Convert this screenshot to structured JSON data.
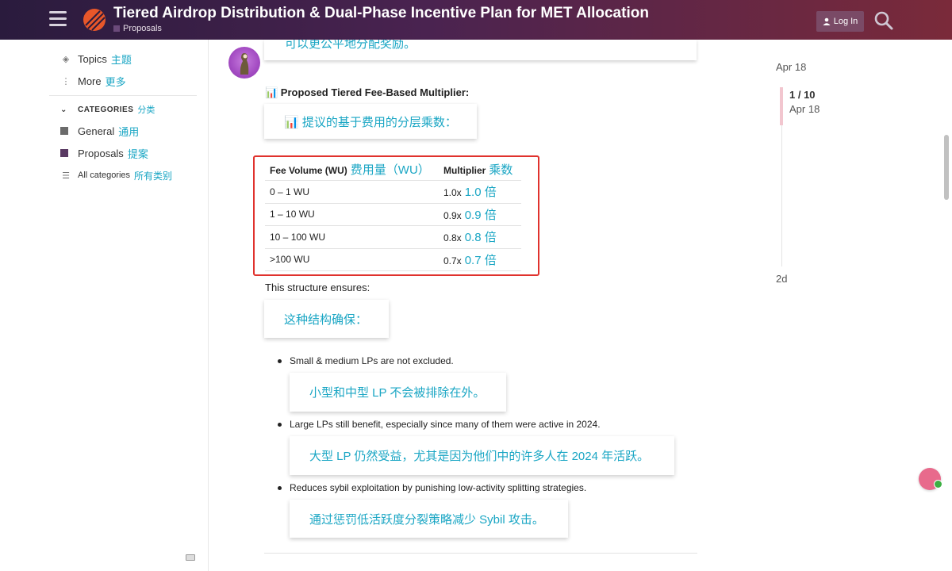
{
  "header": {
    "title": "Tiered Airdrop Distribution & Dual-Phase Incentive Plan for MET Allocation",
    "category": "Proposals",
    "login_label": "Log In"
  },
  "sidebar": {
    "topics": {
      "label": "Topics",
      "zh": "主题"
    },
    "more": {
      "label": "More",
      "zh": "更多"
    },
    "categories_heading": {
      "label": "CATEGORIES",
      "zh": "分类"
    },
    "categories": [
      {
        "label": "General",
        "zh": "通用",
        "color": "#6b6b6b"
      },
      {
        "label": "Proposals",
        "zh": "提案",
        "color": "#5a3a63"
      }
    ],
    "all_categories": {
      "label": "All categories",
      "zh": "所有类别"
    }
  },
  "post": {
    "top_translation": "可以更公平地分配奖励。",
    "heading_en": "📊 Proposed Tiered Fee-Based Multiplier:",
    "heading_zh": "📊 提议的基于费用的分层乘数：",
    "table": {
      "headers": [
        {
          "en": "Fee Volume (WU)",
          "zh": "费用量（WU）"
        },
        {
          "en": "Multiplier",
          "zh": "乘数"
        }
      ],
      "rows": [
        {
          "volume": "0 – 1 WU",
          "mult": "1.0x",
          "mult_zh": "1.0 倍"
        },
        {
          "volume": "1 – 10 WU",
          "mult": "0.9x",
          "mult_zh": "0.9 倍"
        },
        {
          "volume": "10 – 100 WU",
          "mult": "0.8x",
          "mult_zh": "0.8 倍"
        },
        {
          "volume": ">100 WU",
          "mult": "0.7x",
          "mult_zh": "0.7 倍"
        }
      ]
    },
    "ensures_en": "This structure ensures:",
    "ensures_zh": "这种结构确保：",
    "bullets": [
      {
        "en": "Small & medium LPs are not excluded.",
        "zh": "小型和中型 LP 不会被排除在外。"
      },
      {
        "en": "Large LPs still benefit, especially since many of them were active in 2024.",
        "zh": "大型 LP 仍然受益，尤其是因为他们中的许多人在 2024 年活跃。"
      },
      {
        "en": "Reduces sybil exploitation by punishing low-activity splitting strategies.",
        "zh": "通过惩罚低活跃度分裂策略减少 Sybil 攻击。"
      }
    ]
  },
  "timeline": {
    "start_date": "Apr 18",
    "position": "1 / 10",
    "position_date": "Apr 18",
    "end_date": "2d"
  },
  "colors": {
    "accent_translation": "#1aa6c4",
    "highlight_border": "#e0322d"
  }
}
